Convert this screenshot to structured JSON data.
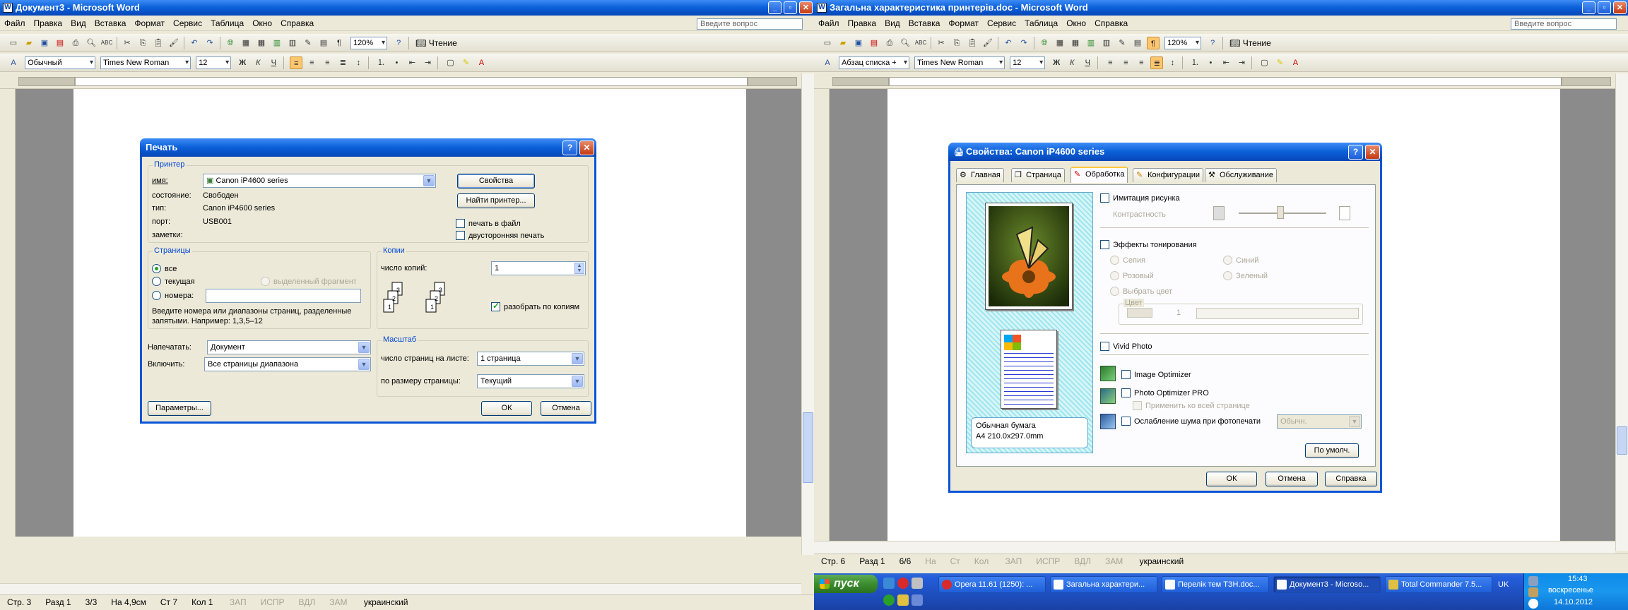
{
  "left_window": {
    "title": "Документ3 - Microsoft Word",
    "menu": [
      "Файл",
      "Правка",
      "Вид",
      "Вставка",
      "Формат",
      "Сервис",
      "Таблица",
      "Окно",
      "Справка"
    ],
    "ask_placeholder": "Введите вопрос",
    "zoom": "120%",
    "reading_label": "Чтение",
    "style": "Обычный",
    "font": "Times New Roman",
    "size": "12",
    "status": [
      "Стр. 3",
      "Разд 1",
      "3/3",
      "На 4,9см",
      "Ст 7",
      "Кол 1"
    ],
    "status_modes": [
      "ЗАП",
      "ИСПР",
      "ВДЛ",
      "ЗАМ"
    ],
    "language": "украинский"
  },
  "print_dialog": {
    "title": "Печать",
    "printer_group": "Принтер",
    "name_label": "имя:",
    "printer_name": "Canon iP4600 series",
    "state_label": "состояние:",
    "state_value": "Свободен",
    "type_label": "тип:",
    "type_value": "Canon iP4600 series",
    "port_label": "порт:",
    "port_value": "USB001",
    "notes_label": "заметки:",
    "properties_button": "Свойства",
    "find_printer_button": "Найти принтер...",
    "print_to_file": "печать в файл",
    "duplex": "двусторонняя печать",
    "pages_group": "Страницы",
    "all": "все",
    "current": "текущая",
    "selection": "выделенный фрагмент",
    "numbers": "номера:",
    "hint": "Введите номера или диапазоны страниц, разделенные запятыми. Например: 1,3,5–12",
    "copies_group": "Копии",
    "copies_label": "число копий:",
    "copies_value": "1",
    "collate": "разобрать по копиям",
    "print_what_label": "Напечатать:",
    "print_what_value": "Документ",
    "include_label": "Включить:",
    "include_value": "Все страницы диапазона",
    "scale_group": "Масштаб",
    "pages_per_sheet_label": "число страниц на листе:",
    "pages_per_sheet_value": "1 страница",
    "fit_label": "по размеру страницы:",
    "fit_value": "Текущий",
    "options_button": "Параметры...",
    "ok_button": "ОК",
    "cancel_button": "Отмена"
  },
  "right_window": {
    "title": "Загальна характеристика принтерів.doc - Microsoft Word",
    "menu": [
      "Файл",
      "Правка",
      "Вид",
      "Вставка",
      "Формат",
      "Сервис",
      "Таблица",
      "Окно",
      "Справка"
    ],
    "ask_placeholder": "Введите вопрос",
    "zoom": "120%",
    "reading_label": "Чтение",
    "style": "Абзац списка +",
    "font": "Times New Roman",
    "size": "12",
    "status": [
      "Стр. 6",
      "Разд 1",
      "6/6",
      "На",
      "Ст",
      "Кол"
    ],
    "status_modes": [
      "ЗАП",
      "ИСПР",
      "ВДЛ",
      "ЗАМ"
    ],
    "language": "украинский"
  },
  "properties_dialog": {
    "title": "Свойства: Canon iP4600 series",
    "tabs": [
      "Главная",
      "Страница",
      "Обработка",
      "Конфигурации",
      "Обслуживание"
    ],
    "illustration": "Имитация рисунка",
    "contrast": "Контрастность",
    "toning": "Эффекты тонирования",
    "sepia": "Сепия",
    "blue": "Синий",
    "pink": "Розовый",
    "green": "Зеленый",
    "pick_color": "Выбрать цвет",
    "color_group": "Цвет",
    "color_value": "1",
    "vivid": "Vivid Photo",
    "image_optimizer": "Image Optimizer",
    "photo_optimizer": "Photo Optimizer PRO",
    "apply_all": "Применить ко всей странице",
    "noise": "Ослабление шума при фотопечати",
    "noise_value": "Обычн.",
    "paper_line1": "Обычная бумага",
    "paper_line2": "A4 210.0x297.0mm",
    "defaults_button": "По умолч.",
    "ok_button": "ОК",
    "cancel_button": "Отмена",
    "help_button": "Справка"
  },
  "taskbar": {
    "start": "пуск",
    "tasks": [
      "Opera 11.61 (1250): ...",
      "Загальна характери...",
      "Перелік тем ТЗН.doc...",
      "Документ3 - Microso...",
      "Total Commander 7.5..."
    ],
    "lang": "UK",
    "time": "15:43",
    "day": "воскресенье",
    "date": "14.10.2012"
  },
  "colors": {
    "titlebar": "#0a5fd8",
    "chrome": "#ece9d8",
    "accent": "#0046d5"
  }
}
